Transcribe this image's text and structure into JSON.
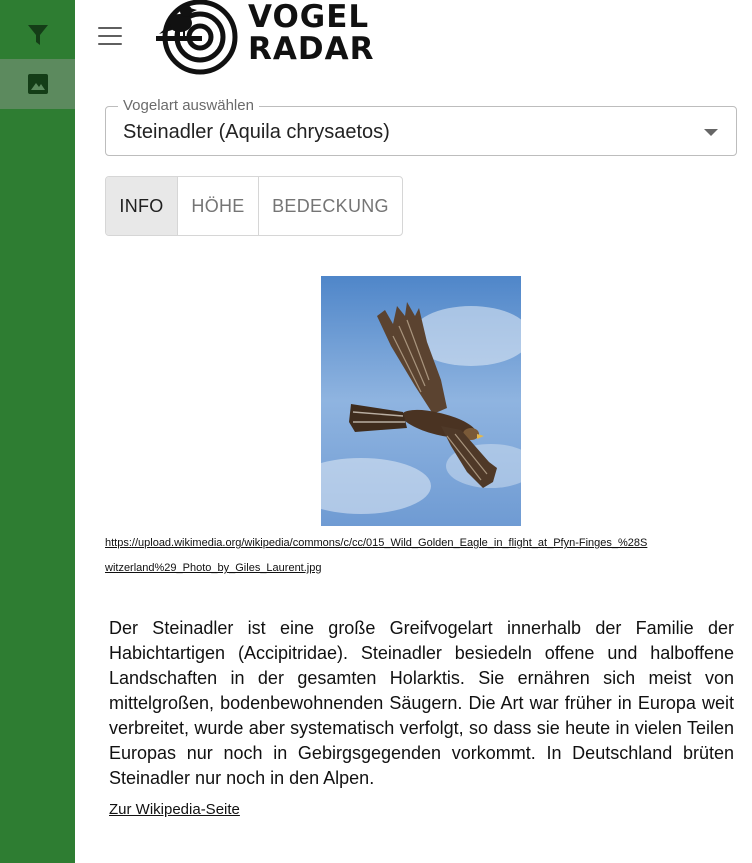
{
  "sidebar": {
    "items": [
      {
        "icon": "filter-icon",
        "active": false
      },
      {
        "icon": "image-icon",
        "active": true
      }
    ]
  },
  "header": {
    "menu_icon": "menu-icon",
    "logo_line1": "VOGEL",
    "logo_line2": "RADAR"
  },
  "species_select": {
    "label": "Vogelart auswählen",
    "value": "Steinadler (Aquila chrysaetos)"
  },
  "tabs": [
    {
      "label": "INFO",
      "active": true
    },
    {
      "label": "HÖHE",
      "active": false
    },
    {
      "label": "BEDECKUNG",
      "active": false
    }
  ],
  "image": {
    "source_url": "https://upload.wikimedia.org/wikipedia/commons/c/cc/015_Wild_Golden_Eagle_in_flight_at_Pfyn-Finges_%28Switzerland%29_Photo_by_Giles_Laurent.jpg"
  },
  "description": "Der Steinadler ist eine große Greifvogelart innerhalb der Familie der Habichtartigen (Accipitridae). Steinadler besiedeln offene und halboffene Landschaften in der gesamten Holarktis. Sie ernähren sich meist von mittelgroßen, bodenbewohnenden Säugern. Die Art war früher in Europa weit verbreitet, wurde aber systematisch verfolgt, so dass sie heute in vielen Teilen Europas nur noch in Gebirgsgegenden vorkommt. In Deutschland brüten Steinadler nur noch in den Alpen.",
  "wiki_link": "Zur Wikipedia-Seite",
  "colors": {
    "sidebar": "#2e7d32",
    "sidebar_active": "#5c8a5e",
    "tab_active_bg": "#e8e8e8"
  }
}
